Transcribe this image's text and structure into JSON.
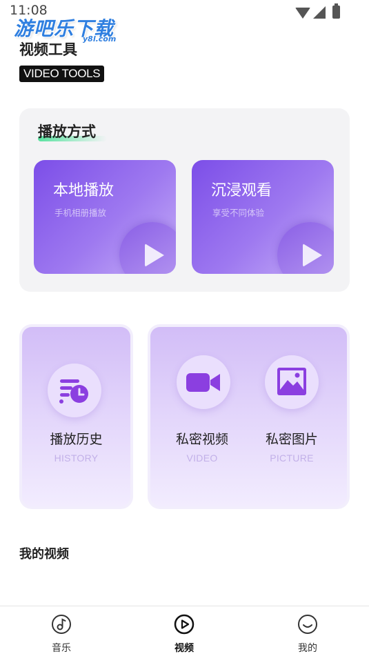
{
  "status_bar": {
    "time": "11:08"
  },
  "watermark": {
    "main": "游吧乐下载",
    "sub": "y8l.com"
  },
  "header": {
    "title": "视频工具",
    "subtitle": "VIDEO TOOLS"
  },
  "play_section": {
    "title": "播放方式",
    "cards": [
      {
        "title": "本地播放",
        "desc": "手机相册播放",
        "icon": "play-icon"
      },
      {
        "title": "沉浸观看",
        "desc": "享受不同体验",
        "icon": "play-icon"
      }
    ]
  },
  "tools": {
    "history": {
      "label": "播放历史",
      "sub": "HISTORY",
      "icon": "history-list-icon"
    },
    "private_video": {
      "label": "私密视频",
      "sub": "VIDEO",
      "icon": "video-camera-icon"
    },
    "private_picture": {
      "label": "私密图片",
      "sub": "PICTURE",
      "icon": "picture-icon"
    }
  },
  "my_videos": {
    "title": "我的视频"
  },
  "bottom_nav": {
    "active": "视频",
    "items": [
      {
        "label": "音乐",
        "icon": "music-note-icon"
      },
      {
        "label": "视频",
        "icon": "play-circle-icon"
      },
      {
        "label": "我的",
        "icon": "smiley-icon"
      }
    ]
  },
  "colors": {
    "accent_purple": "#7c4ee8",
    "light_purple": "#d2bdf7",
    "icon_purple": "#8b3fe0",
    "highlight_green": "#59e2a0",
    "section_bg": "#f3f3f5"
  }
}
